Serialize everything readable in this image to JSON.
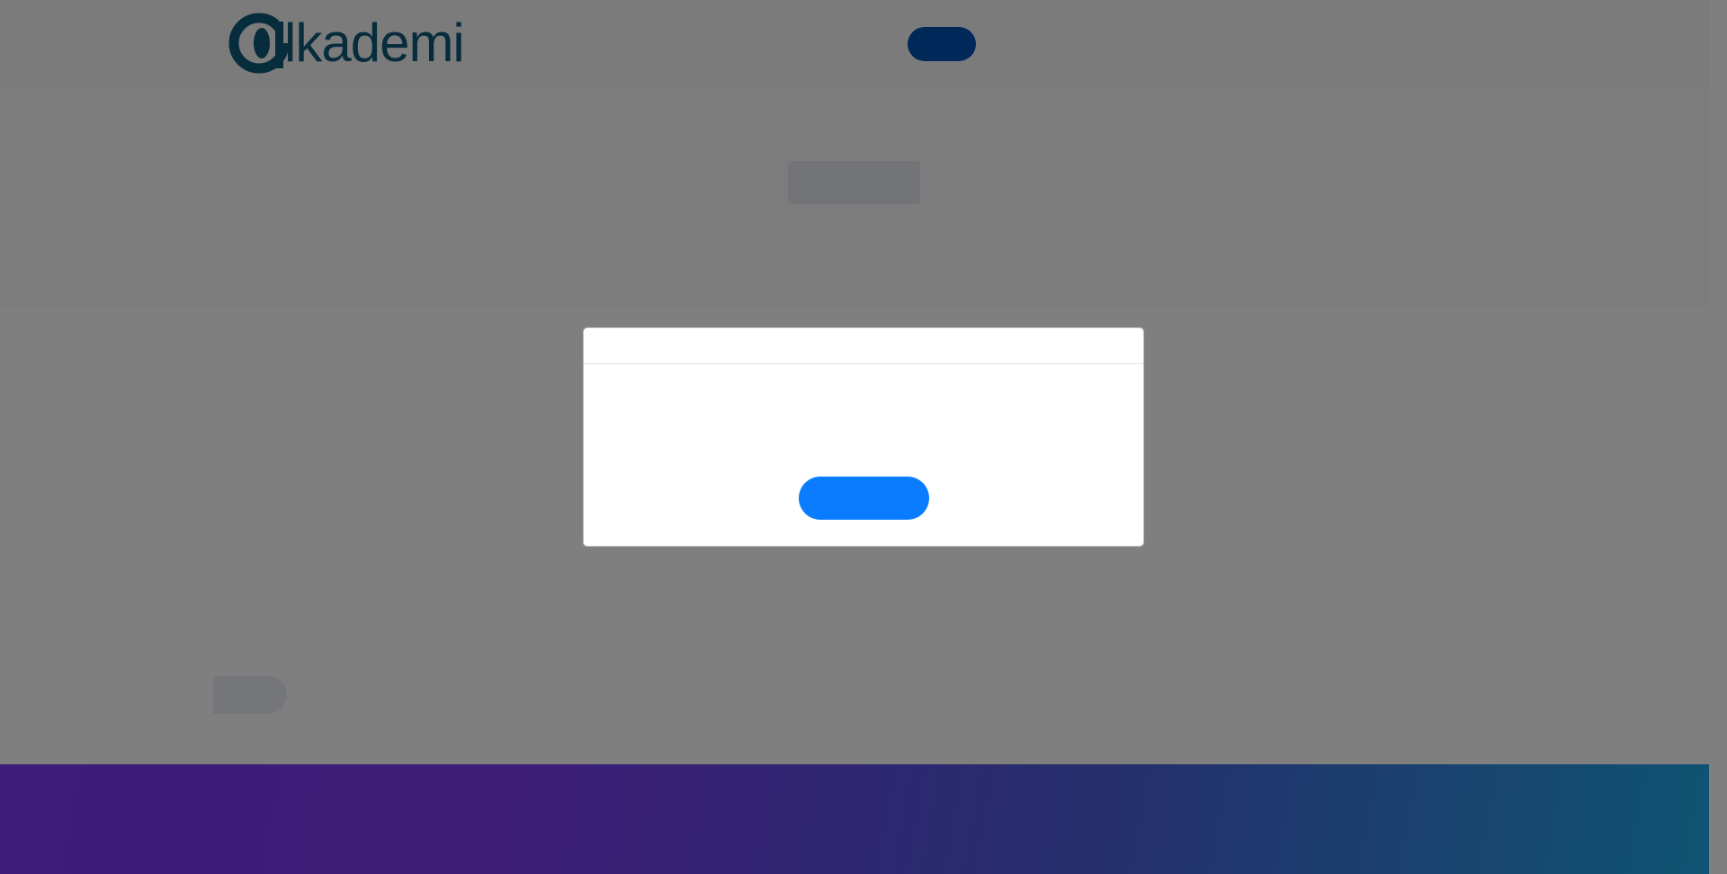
{
  "app": {
    "logo_text": "lkadem",
    "logo_text_tail": "i",
    "logo_icon": "alkademi-logo-icon"
  },
  "header": {
    "button_label": ""
  },
  "hero": {
    "placeholder_label": ""
  },
  "modal": {
    "title": "",
    "body": "",
    "button_label": ""
  },
  "content": {
    "pill_label": ""
  },
  "colors": {
    "brand": "#0f5b7a",
    "primary_button": "#0a7cff",
    "header_button": "#0053b3",
    "footer_gradient_start": "#7a38f4",
    "footer_gradient_end": "#1fa7e6"
  }
}
